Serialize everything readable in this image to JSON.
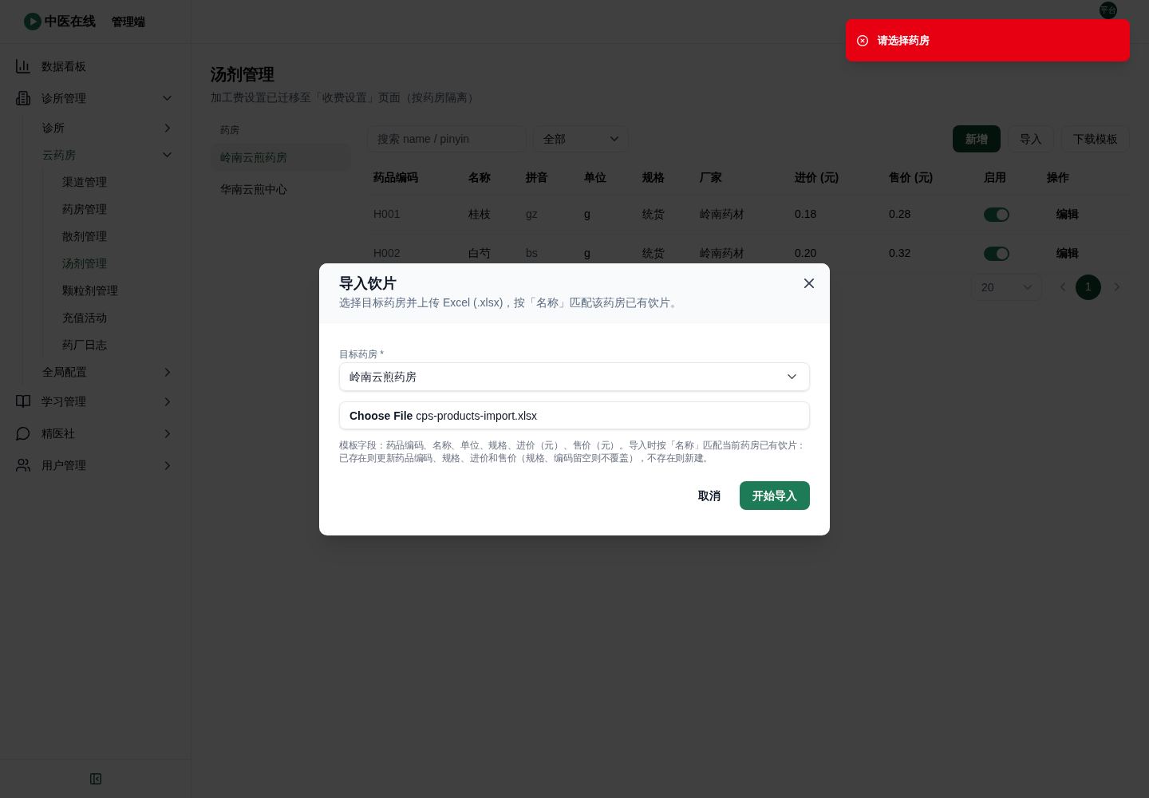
{
  "header": {
    "logo_text": "中医在线",
    "app_label": "管理端",
    "avatar_text": "平台"
  },
  "sidebar": {
    "items": [
      {
        "label": "数据看板",
        "selected": false
      },
      {
        "label": "诊所管理",
        "selected": false,
        "expanded": true,
        "children": [
          {
            "label": "诊所",
            "selected": false,
            "expanded": false
          },
          {
            "label": "云药房",
            "selected": true,
            "expanded": true,
            "children": [
              {
                "label": "渠道管理",
                "selected": false
              },
              {
                "label": "药房管理",
                "selected": false
              },
              {
                "label": "散剂管理",
                "selected": false
              },
              {
                "label": "汤剂管理",
                "selected": true
              },
              {
                "label": "颗粒剂管理",
                "selected": false
              },
              {
                "label": "充值活动",
                "selected": false
              },
              {
                "label": "药厂日志",
                "selected": false
              }
            ]
          },
          {
            "label": "全局配置",
            "selected": false,
            "expanded": false
          }
        ]
      },
      {
        "label": "学习管理",
        "selected": false,
        "expanded": false
      },
      {
        "label": "精医社",
        "selected": false,
        "expanded": false
      },
      {
        "label": "用户管理",
        "selected": false,
        "expanded": false
      }
    ]
  },
  "page": {
    "title": "汤剂管理",
    "subtitle": "加工费设置已迁移至「收费设置」页面（按药房隔离）"
  },
  "pharmacy_panel": {
    "label": "药房",
    "items": [
      {
        "label": "岭南云煎药房",
        "selected": true
      },
      {
        "label": "华南云煎中心",
        "selected": false
      }
    ]
  },
  "toolbar": {
    "search": {
      "placeholder": "搜索 name / pinyin"
    },
    "filter": {
      "value": "全部"
    },
    "buttons": [
      {
        "label": "新增",
        "kind": "primary"
      },
      {
        "label": "导入",
        "kind": "outline"
      },
      {
        "label": "下载模板",
        "kind": "outline"
      }
    ]
  },
  "table": {
    "columns": [
      "药品编码",
      "名称",
      "拼音",
      "单位",
      "规格",
      "厂家",
      "进价 (元)",
      "售价 (元)",
      "启用",
      "操作"
    ],
    "rows": [
      {
        "cells": [
          "H001",
          "桂枝",
          "gz",
          "g",
          "统货",
          "岭南药材",
          "0.18",
          "0.28"
        ],
        "enabled": true,
        "action": "编辑"
      },
      {
        "cells": [
          "H002",
          "白芍",
          "bs",
          "g",
          "统货",
          "岭南药材",
          "0.20",
          "0.32"
        ],
        "enabled": true,
        "action": "编辑"
      }
    ]
  },
  "pagination": {
    "page_size": "20",
    "pages": [
      {
        "label": "1",
        "selected": true
      }
    ]
  },
  "dialog": {
    "title": "导入饮片",
    "description": "选择目标药房并上传 Excel (.xlsx)，按「名称」匹配该药房已有饮片。",
    "field_label": "目标药房 *",
    "select_value": "岭南云煎药房",
    "file": {
      "button": "Choose File",
      "name": "cps-products-import.xlsx"
    },
    "help": "模板字段：药品编码、名称、单位、规格、进价（元）、售价（元）。导入时按「名称」匹配当前药房已有饮片：已存在则更新药品编码、规格、进价和售价（规格、编码留空则不覆盖），不存在则新建。",
    "buttons": [
      {
        "label": "取消",
        "kind": "text"
      },
      {
        "label": "开始导入",
        "kind": "primary"
      }
    ]
  },
  "toast": {
    "kind": "error",
    "message": "请选择药房"
  }
}
